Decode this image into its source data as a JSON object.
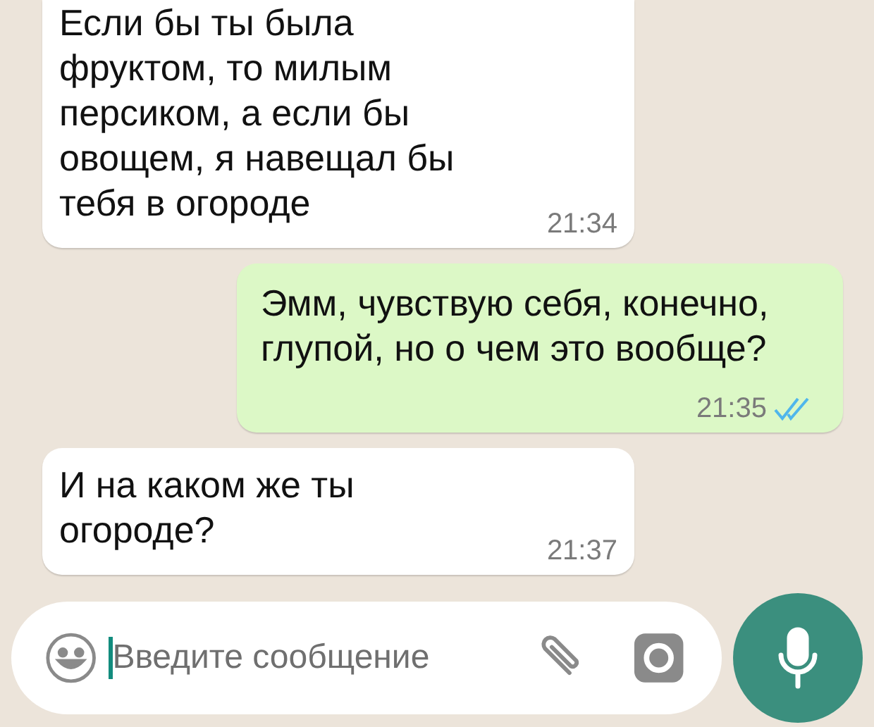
{
  "messages": [
    {
      "kind": "incoming",
      "text": "Если бы ты была\nфруктом, то милым\nперсиком, а если бы\nовощем, я навещал бы\nтебя в огороде",
      "time": "21:34"
    },
    {
      "kind": "outgoing",
      "text": "Эмм, чувствую себя, конечно,\nглупой, но о чем это вообще?",
      "time": "21:35",
      "read": true
    },
    {
      "kind": "incoming",
      "text": "И на каком же ты\nогороде?",
      "time": "21:37"
    }
  ],
  "composer": {
    "placeholder": "Введите сообщение"
  }
}
